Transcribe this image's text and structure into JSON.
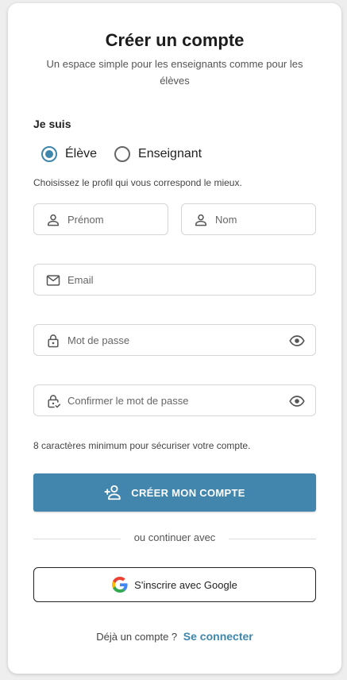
{
  "header": {
    "title": "Créer un compte",
    "subtitle": "Un espace simple pour les enseignants comme pour les élèves"
  },
  "role": {
    "label": "Je suis",
    "options": [
      {
        "label": "Élève",
        "selected": true
      },
      {
        "label": "Enseignant",
        "selected": false
      }
    ],
    "helper": "Choisissez le profil qui vous correspond le mieux."
  },
  "fields": {
    "first_name": {
      "placeholder": "Prénom",
      "value": ""
    },
    "last_name": {
      "placeholder": "Nom",
      "value": ""
    },
    "email": {
      "placeholder": "Email",
      "value": ""
    },
    "password": {
      "placeholder": "Mot de passe",
      "value": ""
    },
    "confirm_password": {
      "placeholder": "Confirmer le mot de passe",
      "value": ""
    }
  },
  "password_hint": "8 caractères minimum pour sécuriser votre compte.",
  "actions": {
    "create_account": "CRÉER MON COMPTE",
    "divider": "ou continuer avec",
    "google": "S'inscrire avec Google"
  },
  "footer": {
    "prompt": "Déjà un compte ?",
    "login_link": "Se connecter"
  },
  "colors": {
    "accent": "#4286ad",
    "link": "#3e86ab"
  },
  "icons": [
    "user-icon",
    "mail-icon",
    "lock-icon",
    "lock-check-icon",
    "eye-icon",
    "add-user-icon",
    "google-icon"
  ]
}
